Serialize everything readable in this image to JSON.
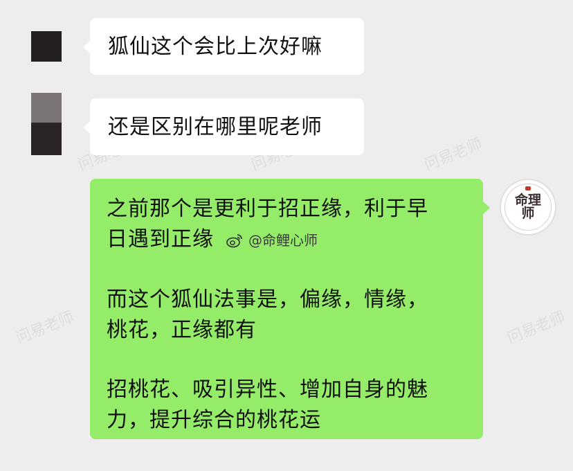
{
  "messages": [
    {
      "side": "left",
      "text": "狐仙这个会比上次好嘛"
    },
    {
      "side": "left",
      "text": "还是区别在哪里呢老师"
    },
    {
      "side": "right",
      "paragraphs": [
        "之前那个是更利于招正缘，利于早\n日遇到正缘",
        "而这个狐仙法事是，偏缘，情缘，\n桃花，正缘都有",
        "招桃花、吸引异性、增加自身的魅\n力，提升综合的桃花运"
      ]
    }
  ],
  "weibo_watermark": "@命鲤心师",
  "watermarks": [
    "问易老师",
    "问易老师",
    "问易老师",
    "问易老师",
    "问易老师",
    "问易老师"
  ],
  "avatar_logo": {
    "text": "命理师"
  },
  "colors": {
    "background": "#ededed",
    "bubble_left": "#ffffff",
    "bubble_right": "#95ec69"
  }
}
